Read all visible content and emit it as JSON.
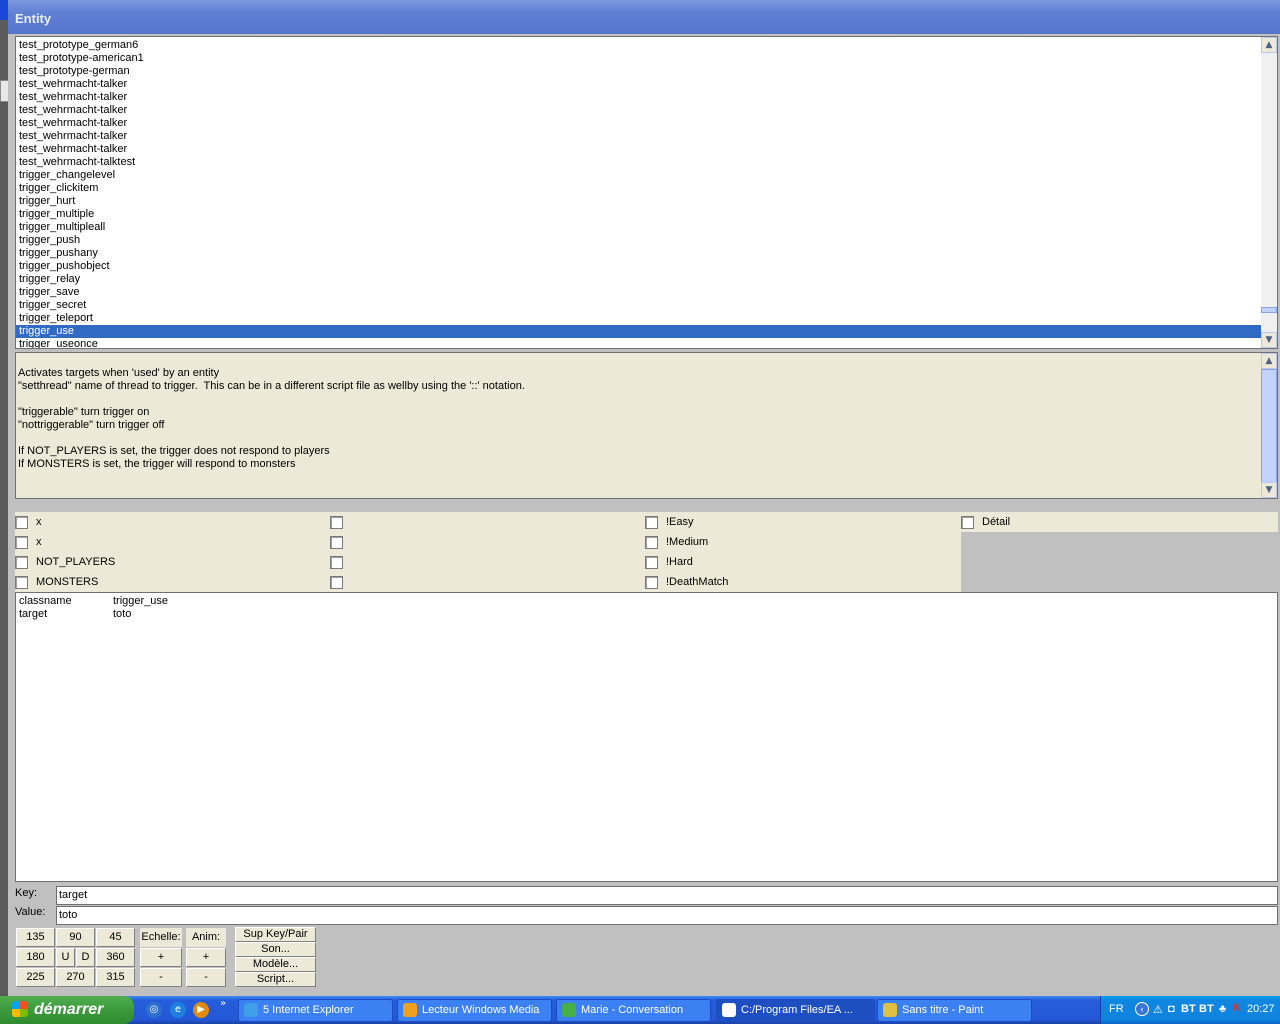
{
  "window": {
    "title": "Entity"
  },
  "entity_list": {
    "items": [
      "test_prototype_german6",
      "test_prototype-american1",
      "test_prototype-german",
      "test_wehrmacht-talker",
      "test_wehrmacht-talker",
      "test_wehrmacht-talker",
      "test_wehrmacht-talker",
      "test_wehrmacht-talker",
      "test_wehrmacht-talker",
      "test_wehrmacht-talktest",
      "trigger_changelevel",
      "trigger_clickitem",
      "trigger_hurt",
      "trigger_multiple",
      "trigger_multipleall",
      "trigger_push",
      "trigger_pushany",
      "trigger_pushobject",
      "trigger_relay",
      "trigger_save",
      "trigger_secret",
      "trigger_teleport",
      "trigger_use",
      "trigger_useonce"
    ],
    "selected": "trigger_use"
  },
  "description": {
    "lines": [
      "Activates targets when 'used' by an entity",
      "\"setthread\" name of thread to trigger.  This can be in a different script file as wellby using the '::' notation.",
      "",
      "\"triggerable\" turn trigger on",
      "\"nottriggerable\" turn trigger off",
      "",
      "If NOT_PLAYERS is set, the trigger does not respond to players",
      "If MONSTERS is set, the trigger will respond to monsters"
    ]
  },
  "flags": {
    "col1": [
      "x",
      "x",
      "NOT_PLAYERS",
      "MONSTERS"
    ],
    "col2": [
      "",
      "",
      "",
      ""
    ],
    "col3": [
      "!Easy",
      "!Medium",
      "!Hard",
      "!DeathMatch"
    ],
    "col4": [
      "Détail"
    ]
  },
  "keyvalues": [
    {
      "key": "classname",
      "value": "trigger_use"
    },
    {
      "key": "target",
      "value": "toto"
    }
  ],
  "key_field": {
    "label": "Key:",
    "value": "target"
  },
  "value_field": {
    "label": "Value:",
    "value": "toto"
  },
  "angle_buttons": {
    "a135": "135",
    "a90": "90",
    "a45": "45",
    "a180": "180",
    "u": "U",
    "d": "D",
    "a360": "360",
    "a225": "225",
    "a270": "270",
    "a315": "315"
  },
  "scale": {
    "label": "Echelle:",
    "plus": "+",
    "minus": "-"
  },
  "anim": {
    "label": "Anim:",
    "plus": "+",
    "minus": "-"
  },
  "actions": {
    "sup": "Sup Key/Pair",
    "son": "Son...",
    "modele": "Modèle...",
    "script": "Script..."
  },
  "taskbar": {
    "start": "démarrer",
    "items": [
      {
        "label": "5 Internet Explorer",
        "icon": "ie-icon"
      },
      {
        "label": "Lecteur Windows Media",
        "icon": "media-player-icon"
      },
      {
        "label": "Marie - Conversation",
        "icon": "messenger-icon"
      },
      {
        "label": "C:/Program Files/EA ...",
        "icon": "window-icon"
      },
      {
        "label": "Sans titre - Paint",
        "icon": "paint-icon"
      }
    ],
    "lang": "FR",
    "tray_labels": [
      "BT",
      "BT"
    ],
    "clock": "20:27"
  },
  "colors": {
    "selection": "#316ac5",
    "panel": "#ece9d8",
    "taskbar": "#245edb",
    "start": "#3c9a3c"
  }
}
